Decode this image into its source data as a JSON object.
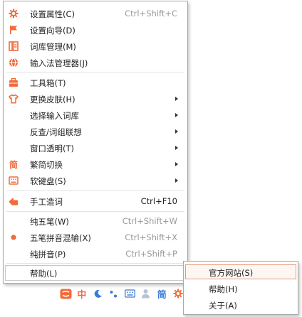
{
  "menu": {
    "items": [
      {
        "label": "设置属性(C)",
        "shortcut": "Ctrl+Shift+C",
        "icon": "gear-icon"
      },
      {
        "label": "设置向导(D)",
        "shortcut": "",
        "icon": "flag-icon"
      },
      {
        "label": "词库管理(M)",
        "shortcut": "",
        "icon": "dictionary-icon"
      },
      {
        "label": "输入法管理器(J)",
        "shortcut": "",
        "icon": "globe-icon"
      },
      {
        "label": "工具箱(T)",
        "shortcut": "",
        "icon": "toolbox-icon"
      },
      {
        "label": "更换皮肤(H)",
        "shortcut": "",
        "icon": "shirt-icon"
      },
      {
        "label": "选择输入词库",
        "shortcut": "",
        "icon": ""
      },
      {
        "label": "反查/词组联想",
        "shortcut": "",
        "icon": ""
      },
      {
        "label": "窗口透明(T)",
        "shortcut": "",
        "icon": ""
      },
      {
        "label": "繁简切换",
        "shortcut": "",
        "icon": "traditional-char-icon",
        "icon_text": "简"
      },
      {
        "label": "软键盘(S)",
        "shortcut": "",
        "icon": "keyboard-icon"
      },
      {
        "label": "手工造词",
        "shortcut": "Ctrl+F10",
        "icon": "hand-icon"
      },
      {
        "label": "纯五笔(W)",
        "shortcut": "Ctrl+Shift+W",
        "icon": ""
      },
      {
        "label": "五笔拼音混输(X)",
        "shortcut": "Ctrl+Shift+X",
        "icon": "radio-dot-icon"
      },
      {
        "label": "纯拼音(P)",
        "shortcut": "Ctrl+Shift+P",
        "icon": ""
      },
      {
        "label": "帮助(L)",
        "shortcut": "",
        "icon": ""
      }
    ]
  },
  "submenu": {
    "items": [
      {
        "label": "官方网站(S)"
      },
      {
        "label": "帮助(H)"
      },
      {
        "label": "关于(A)"
      }
    ]
  },
  "toolbar": {
    "mode_label": "中",
    "charset_label": "简",
    "icons": [
      "logo-icon",
      "moon-icon",
      "punctuation-icon",
      "keyboard-icon",
      "user-icon",
      "gear-icon"
    ]
  },
  "colors": {
    "accent": "#f26b3a",
    "blue": "#3a7bd5",
    "shortcut_gray": "#9a9a9a"
  }
}
